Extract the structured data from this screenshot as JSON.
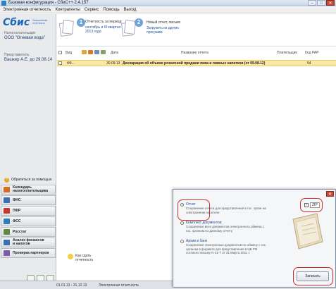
{
  "window": {
    "title": "Базовая конфигурация - СбиС++ 2.4.157",
    "buttons": {
      "minimize": "–",
      "maximize": "□",
      "close": "✕"
    }
  },
  "menu": [
    "Электронная отчетность",
    "Контрагенты",
    "Сервис",
    "Помощь",
    "Выход"
  ],
  "sidebar": {
    "logo_text": "Сбис",
    "logo_sub": "Электронная отчетность",
    "taxpayer_label": "Налогоплательщик",
    "taxpayer_value": "ООО \"Огневая вода\"",
    "representative_label": "Представитель",
    "representative_value": "Вашкер А.Е. до 29.08.14",
    "help": "Обратиться за помощью",
    "nav": [
      {
        "label": "Календарь\nналогоплательщика",
        "icon": "calendar-icon",
        "color": "#d96c1f"
      },
      {
        "label": "ФНС",
        "icon": "fns-icon",
        "color": "#3d6fb6"
      },
      {
        "label": "ПФР",
        "icon": "pfr-icon",
        "color": "#c8382c"
      },
      {
        "label": "ФСС",
        "icon": "fss-icon",
        "color": "#2e7fb9"
      },
      {
        "label": "Росстат",
        "icon": "rosstat-icon",
        "color": "#5a8c3b"
      },
      {
        "label": "Анализ финансов\nи налогов",
        "icon": "chart-icon",
        "color": "#3b6db3"
      },
      {
        "label": "Проверка партнеров",
        "icon": "check-partners-icon",
        "color": "#7b5ca9"
      }
    ]
  },
  "steps": {
    "step1": {
      "num": "1",
      "line1": "Отчетность за период:",
      "line2": "сентябрь и III квартал\n2013 года"
    },
    "step2": {
      "num": "2",
      "line1": "Новый отчет, письмо",
      "line2": "Загрузить из других\nпрограмм"
    }
  },
  "table": {
    "headers": {
      "type": "Вид",
      "date": "Дата",
      "name": "Название отчета",
      "payer": "Плательщик",
      "rar_code": "Код РАР"
    },
    "rows": [
      {
        "type": "Ф9...",
        "date": "30.09.13",
        "name": "Декларация об объеме розничной продажи пива и пивных напитков (от 09.08.12)",
        "payer": "",
        "rar_code": "54"
      }
    ]
  },
  "howto": "Как сдать\nотчетность",
  "status": {
    "period": "01.01.13 - 31.12.13",
    "section": "Электронная отчетность"
  },
  "dialog": {
    "options": [
      {
        "name": "Отчет",
        "desc": "Сохранение отчета для представления в гос. орган на\nэлектронном носителе",
        "selected": true
      },
      {
        "name": "Комплект документов",
        "desc": "Сохранение всех документов электронного обмена с\nгос. органом по данному отчету",
        "selected": false
      },
      {
        "name": "Архив в банк",
        "desc": "Сохранение электронных документов по обмену с гос.\nорганом в формате для представления в ЦБ РФ\nсогласно письму N 41-Т от 31 Марта 2011 г.",
        "selected": false
      }
    ],
    "zip_checked": "✓",
    "zip_label": "ZIP",
    "save_button": "Записать",
    "close": "✕"
  }
}
